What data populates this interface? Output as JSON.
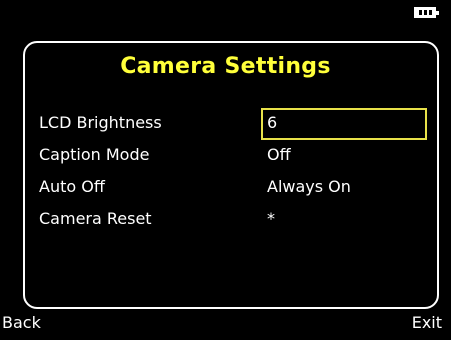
{
  "status": {
    "battery_icon": "battery-full-icon"
  },
  "header": {
    "title": "Camera Settings",
    "title_color": "#ffff3a"
  },
  "settings": [
    {
      "label": "LCD Brightness",
      "value": "6"
    },
    {
      "label": "Caption Mode",
      "value": "Off"
    },
    {
      "label": "Auto Off",
      "value": "Always On"
    },
    {
      "label": "Camera Reset",
      "value": "*"
    }
  ],
  "footer": {
    "back_label": "Back",
    "exit_label": "Exit"
  },
  "colors": {
    "background": "#000000",
    "text": "#ffffff",
    "highlight_border": "#e8e24a"
  }
}
